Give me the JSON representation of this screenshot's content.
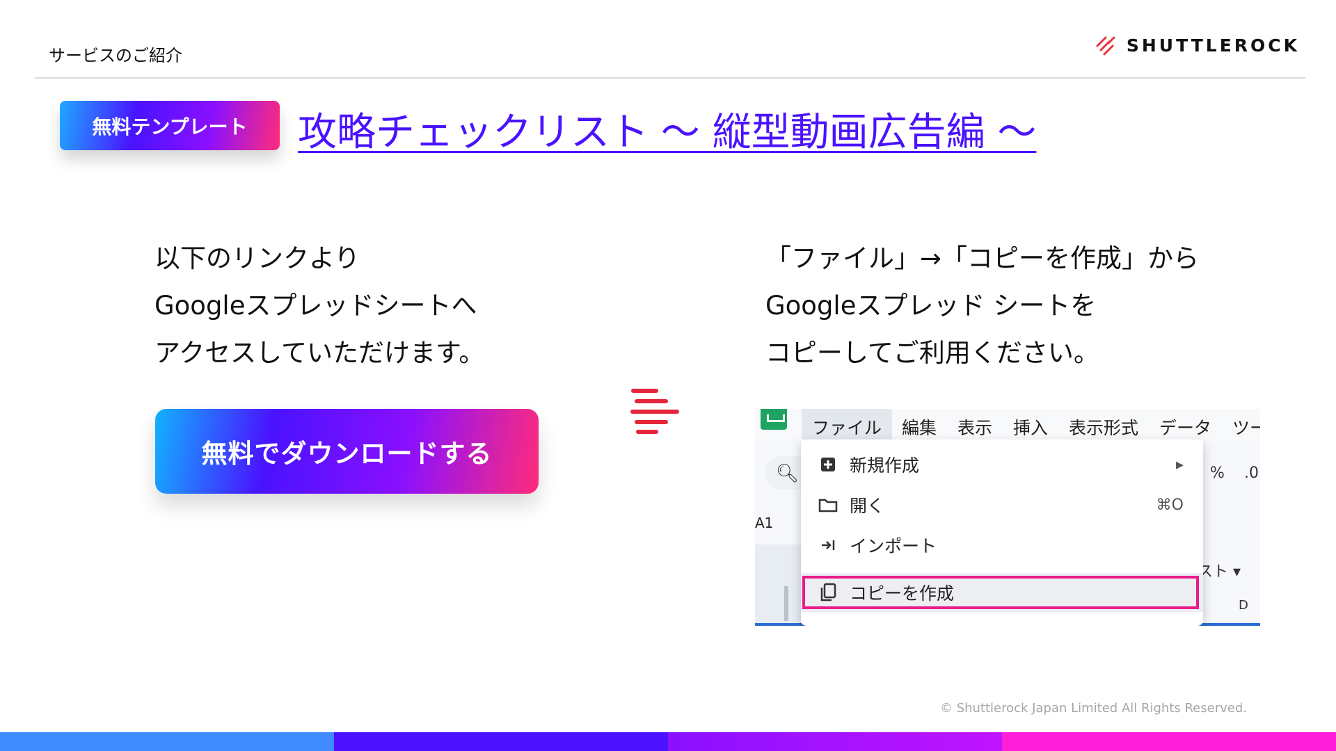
{
  "header": {
    "section_label": "サービスのご紹介",
    "logo_text": "SHUTTLEROCK"
  },
  "badge": {
    "label": "無料テンプレート"
  },
  "title": {
    "link_text": "攻略チェックリスト 〜 縦型動画広告編 〜"
  },
  "left": {
    "lines": [
      "以下のリンクより",
      "Googleスプレッドシートへ",
      "アクセスしていただけます。"
    ],
    "button_label": "無料でダウンロードする"
  },
  "right": {
    "lines": [
      "「ファイル」→「コピーを作成」から",
      "Googleスプレッド シートを",
      "コピーしてご利用ください。"
    ]
  },
  "screenshot": {
    "menu": [
      "ファイル",
      "編集",
      "表示",
      "挿入",
      "表示形式",
      "データ",
      "ツー"
    ],
    "dropdown": [
      {
        "icon": "plus-square-icon",
        "label": "新規作成",
        "right": "▸"
      },
      {
        "icon": "folder-icon",
        "label": "開く",
        "right": "⌘O"
      },
      {
        "icon": "import-arrow-icon",
        "label": "インポート",
        "right": ""
      },
      {
        "icon": "copy-icon",
        "label": "コピーを作成",
        "right": ""
      }
    ],
    "cell_ref": "A1",
    "percent": "%",
    "decimal": ".0",
    "text_format": "スト ▾",
    "col_header": "D"
  },
  "footer": {
    "copyright": "© Shuttlerock Japan Limited All Rights Reserved."
  },
  "colors": {
    "accent_blue": "#4a12ff",
    "highlight_pink": "#ea1c8c",
    "logo_red": "#e8323c"
  }
}
